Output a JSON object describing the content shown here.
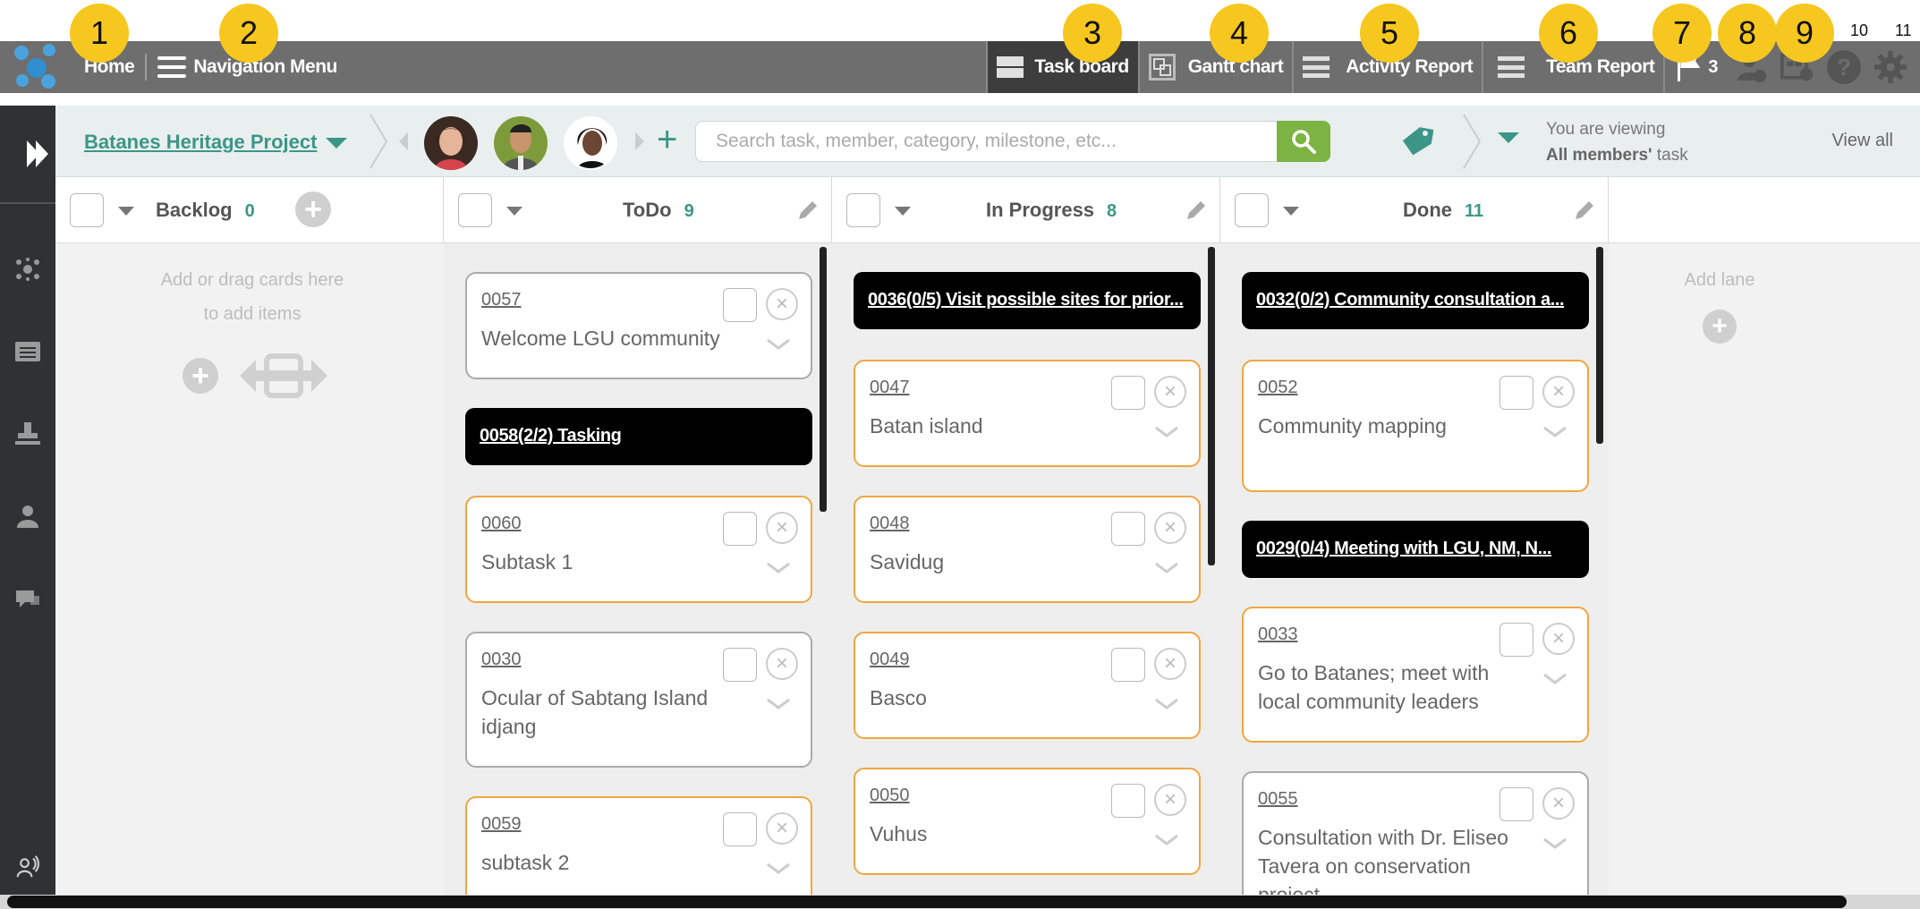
{
  "callouts": [
    "1",
    "2",
    "3",
    "4",
    "5",
    "6",
    "7",
    "8",
    "9",
    "10",
    "11"
  ],
  "topbar": {
    "home": "Home",
    "nav_menu": "Navigation Menu",
    "tabs": [
      {
        "label": "Task board",
        "active": true,
        "icon": "taskboard-icon"
      },
      {
        "label": "Gantt chart",
        "active": false,
        "icon": "gantt-icon"
      },
      {
        "label": "Activity Report",
        "active": false,
        "icon": "activity-report-icon"
      },
      {
        "label": "Team Report",
        "active": false,
        "icon": "team-report-icon"
      }
    ],
    "flag_count": "3",
    "icons": [
      "flag-icon",
      "add-user-icon",
      "calendar-settings-icon",
      "help-icon",
      "gear-icon"
    ]
  },
  "subbar": {
    "project": "Batanes Heritage Project",
    "search_placeholder": "Search task, member, category, milestone, etc...",
    "viewing_line1": "You are viewing",
    "viewing_bold": "All members'",
    "viewing_rest": " task",
    "view_all": "View all"
  },
  "lanes": [
    {
      "name": "Backlog",
      "count": "0",
      "hint1": "Add or drag cards here",
      "hint2": "to add items"
    },
    {
      "name": "ToDo",
      "count": "9"
    },
    {
      "name": "In Progress",
      "count": "8"
    },
    {
      "name": "Done",
      "count": "11"
    }
  ],
  "add_lane": "Add lane",
  "todo_cards": [
    {
      "kind": "card",
      "num": "0057",
      "title": "Welcome LGU community",
      "orange": false
    },
    {
      "kind": "group",
      "title": "0058(2/2) Tasking"
    },
    {
      "kind": "card",
      "num": "0060",
      "title": "Subtask 1",
      "orange": true
    },
    {
      "kind": "card",
      "num": "0030",
      "title": "Ocular of Sabtang Island idjang",
      "orange": false
    },
    {
      "kind": "card",
      "num": "0059",
      "title": "subtask 2",
      "orange": true
    }
  ],
  "progress_cards": [
    {
      "kind": "group",
      "title": "0036(0/5) Visit possible sites for prior..."
    },
    {
      "kind": "card",
      "num": "0047",
      "title": "Batan island",
      "orange": true
    },
    {
      "kind": "card",
      "num": "0048",
      "title": "Savidug",
      "orange": true
    },
    {
      "kind": "card",
      "num": "0049",
      "title": "Basco",
      "orange": true
    },
    {
      "kind": "card",
      "num": "0050",
      "title": "Vuhus",
      "orange": true
    }
  ],
  "done_cards": [
    {
      "kind": "group",
      "title": "0032(0/2) Community consultation a..."
    },
    {
      "kind": "card",
      "num": "0052",
      "title": "Community mapping",
      "orange": true
    },
    {
      "kind": "group",
      "title": "0029(0/4) Meeting with LGU, NM, N..."
    },
    {
      "kind": "card",
      "num": "0033",
      "title": "Go to Batanes; meet with local community leaders",
      "orange": true
    },
    {
      "kind": "card",
      "num": "0055",
      "title": "Consultation with Dr. Eliseo Tavera on conservation project",
      "orange": false
    }
  ],
  "colors": {
    "accent": "#3b9688",
    "orange_border": "#f0a640",
    "search_green": "#7cb342",
    "callout": "#f6c71f",
    "topbar": "#6e6e6e"
  }
}
